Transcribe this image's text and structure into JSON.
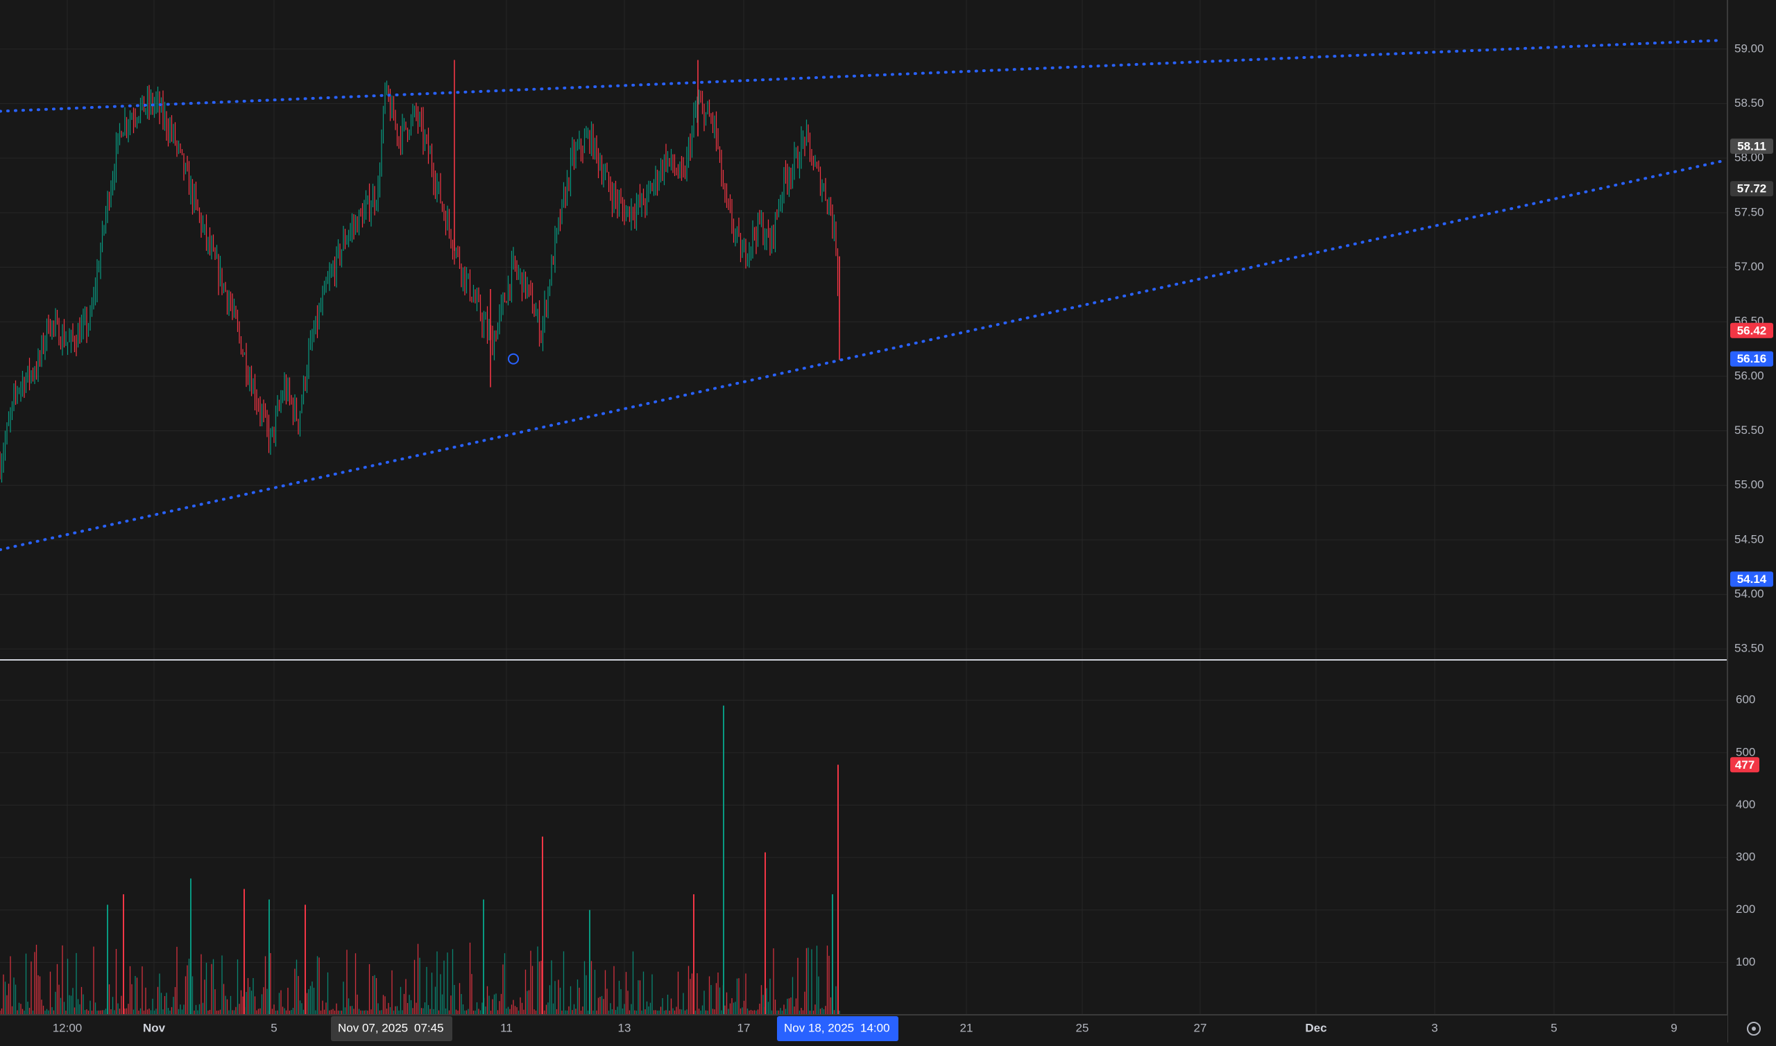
{
  "chart_data": {
    "type": "candlestick",
    "price_axis": {
      "ticks": [
        "59.00",
        "58.50",
        "58.00",
        "57.50",
        "57.00",
        "56.50",
        "56.00",
        "55.50",
        "55.00",
        "54.50",
        "54.00",
        "53.50"
      ],
      "ylim": [
        53.4,
        59.45
      ]
    },
    "volume_axis": {
      "ticks": [
        "600",
        "500",
        "400",
        "300",
        "200",
        "100"
      ],
      "ylim": [
        0,
        640
      ]
    },
    "time_axis": {
      "ticks": [
        "12:00",
        "Nov",
        "5",
        "11",
        "13",
        "17",
        "21",
        "25",
        "27",
        "Dec",
        "3",
        "5",
        "9"
      ]
    },
    "price_labels": [
      {
        "text": "58.11",
        "value": 58.11,
        "color": "#4a4a4a"
      },
      {
        "text": "57.72",
        "value": 57.72,
        "color": "#3a3a3a"
      },
      {
        "text": "56.42",
        "value": 56.42,
        "color": "#f23645"
      },
      {
        "text": "56.16",
        "value": 56.16,
        "color": "#2962ff"
      },
      {
        "text": "54.14",
        "value": 54.14,
        "color": "#2962ff"
      }
    ],
    "volume_label": {
      "text": "477",
      "value": 477,
      "color": "#f23645"
    },
    "crosshair_labels": [
      {
        "date": "Nov 07, 2025",
        "time": "07:45",
        "color": "#3a3a3a"
      },
      {
        "date": "Nov 18, 2025",
        "time": "14:00",
        "color": "#2962ff"
      }
    ],
    "trendlines": [
      {
        "name": "upper",
        "points": [
          [
            0,
            58.43
          ],
          [
            2480,
            59.08
          ]
        ]
      },
      {
        "name": "lower",
        "points": [
          [
            0,
            54.41
          ],
          [
            2480,
            57.97
          ]
        ]
      }
    ],
    "trendline_anchor": [
      740,
      56.16
    ],
    "price_path": [
      [
        0,
        55.2
      ],
      [
        25,
        55.9
      ],
      [
        55,
        56.1
      ],
      [
        70,
        56.5
      ],
      [
        100,
        56.3
      ],
      [
        130,
        56.5
      ],
      [
        155,
        57.6
      ],
      [
        175,
        58.3
      ],
      [
        200,
        58.45
      ],
      [
        225,
        58.5
      ],
      [
        250,
        58.2
      ],
      [
        270,
        57.8
      ],
      [
        300,
        57.2
      ],
      [
        330,
        56.7
      ],
      [
        360,
        56.0
      ],
      [
        390,
        55.4
      ],
      [
        410,
        55.9
      ],
      [
        430,
        55.6
      ],
      [
        445,
        56.2
      ],
      [
        470,
        56.8
      ],
      [
        500,
        57.3
      ],
      [
        525,
        57.5
      ],
      [
        545,
        57.7
      ],
      [
        555,
        58.6
      ],
      [
        575,
        58.2
      ],
      [
        600,
        58.4
      ],
      [
        620,
        58.0
      ],
      [
        640,
        57.5
      ],
      [
        665,
        57.0
      ],
      [
        690,
        56.6
      ],
      [
        710,
        56.3
      ],
      [
        740,
        57.0
      ],
      [
        760,
        56.8
      ],
      [
        780,
        56.4
      ],
      [
        800,
        57.2
      ],
      [
        825,
        58.0
      ],
      [
        850,
        58.2
      ],
      [
        880,
        57.7
      ],
      [
        900,
        57.5
      ],
      [
        930,
        57.6
      ],
      [
        960,
        58.0
      ],
      [
        985,
        57.8
      ],
      [
        1005,
        58.5
      ],
      [
        1030,
        58.3
      ],
      [
        1045,
        57.6
      ],
      [
        1070,
        57.1
      ],
      [
        1095,
        57.4
      ],
      [
        1110,
        57.2
      ],
      [
        1130,
        57.8
      ],
      [
        1150,
        58.0
      ],
      [
        1160,
        58.2
      ],
      [
        1175,
        57.9
      ],
      [
        1195,
        57.6
      ],
      [
        1205,
        57.2
      ],
      [
        1210,
        56.6
      ]
    ],
    "volume_spikes": [
      [
        155,
        210
      ],
      [
        178,
        230
      ],
      [
        275,
        260
      ],
      [
        352,
        240
      ],
      [
        388,
        220
      ],
      [
        440,
        210
      ],
      [
        697,
        220
      ],
      [
        782,
        340
      ],
      [
        850,
        200
      ],
      [
        1000,
        230
      ],
      [
        1043,
        590
      ],
      [
        1103,
        310
      ],
      [
        1200,
        230
      ],
      [
        1208,
        477
      ]
    ],
    "colors": {
      "background": "#181818",
      "grid": "#262626",
      "up": "#089981",
      "down": "#f23645",
      "trendline": "#2962ff",
      "axis_text": "#b2b5be"
    }
  }
}
